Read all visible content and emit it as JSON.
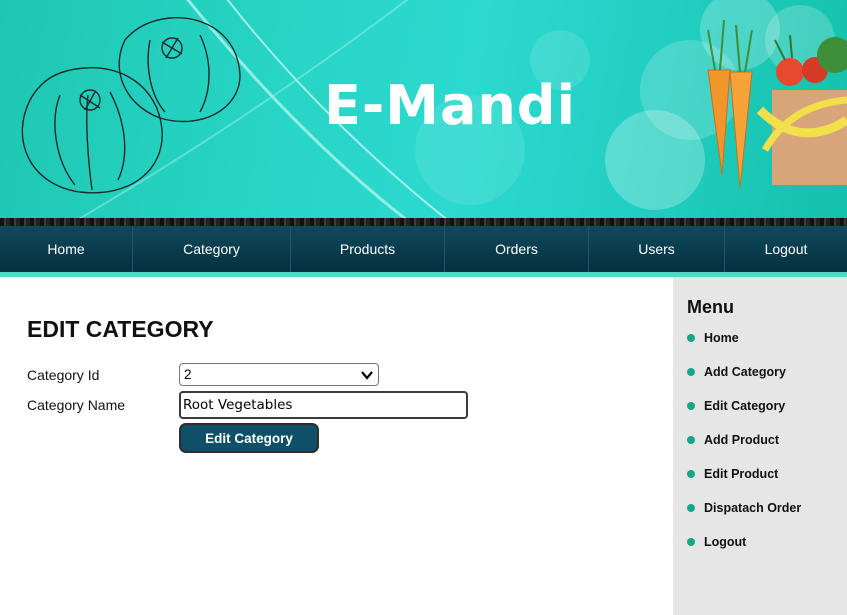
{
  "header": {
    "site_title": "E-Mandi"
  },
  "nav": {
    "items": [
      {
        "label": "Home",
        "icon": ""
      },
      {
        "label": "Category"
      },
      {
        "label": "Products"
      },
      {
        "label": "Orders"
      },
      {
        "label": "Users"
      },
      {
        "label": "Logout"
      }
    ]
  },
  "form": {
    "title": "EDIT CATEGORY",
    "category_id_label": "Category Id",
    "category_id_value": "2",
    "category_name_label": "Category Name",
    "category_name_value": "Root Vegetables",
    "submit_label": "Edit Category"
  },
  "sidebar": {
    "title": "Menu",
    "items": [
      {
        "label": "Home"
      },
      {
        "label": "Add Category"
      },
      {
        "label": "Edit Category"
      },
      {
        "label": "Add Product"
      },
      {
        "label": "Edit Product"
      },
      {
        "label": "Dispatach Order"
      },
      {
        "label": "Logout"
      }
    ]
  },
  "colors": {
    "banner": "#27d6c6",
    "nav": "#0b4458",
    "accent": "#4fd8c4",
    "bullet": "#13a884",
    "button": "#0d5068",
    "sidebar_bg": "#e6e6e6"
  }
}
